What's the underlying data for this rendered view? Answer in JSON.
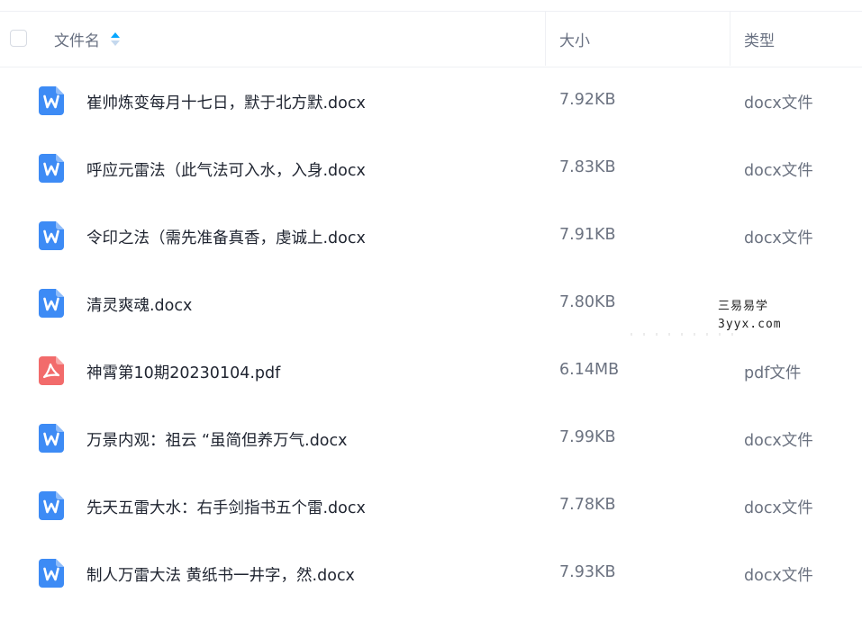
{
  "header": {
    "name_label": "文件名",
    "size_label": "大小",
    "type_label": "类型"
  },
  "files": [
    {
      "name": "崔帅炼变每月十七日，默于北方默.docx",
      "size": "7.92KB",
      "type": "docx文件",
      "icon": "word-doc-icon"
    },
    {
      "name": "呼应元雷法（此气法可入水，入身.docx",
      "size": "7.83KB",
      "type": "docx文件",
      "icon": "word-doc-icon"
    },
    {
      "name": "令印之法（需先准备真香，虔诚上.docx",
      "size": "7.91KB",
      "type": "docx文件",
      "icon": "word-doc-icon"
    },
    {
      "name": "清灵爽魂.docx",
      "size": "7.80KB",
      "type": "",
      "icon": "word-doc-icon"
    },
    {
      "name": "神霄第10期20230104.pdf",
      "size": "6.14MB",
      "type": "pdf文件",
      "icon": "pdf-icon"
    },
    {
      "name": "万景内观：祖云 “虽简但养万气.docx",
      "size": "7.99KB",
      "type": "docx文件",
      "icon": "word-doc-icon"
    },
    {
      "name": "先天五雷大水：右手剑指书五个雷.docx",
      "size": "7.78KB",
      "type": "docx文件",
      "icon": "word-doc-icon"
    },
    {
      "name": "制人万雷大法 黄纸书一井字，然.docx",
      "size": "7.93KB",
      "type": "docx文件",
      "icon": "word-doc-icon"
    }
  ],
  "watermark": {
    "line1": "三易易学",
    "line2": "3yyx.com"
  },
  "colors": {
    "word": "#3d8bf5",
    "pdf": "#f26b6b",
    "sort_active": "#06a7ff"
  }
}
